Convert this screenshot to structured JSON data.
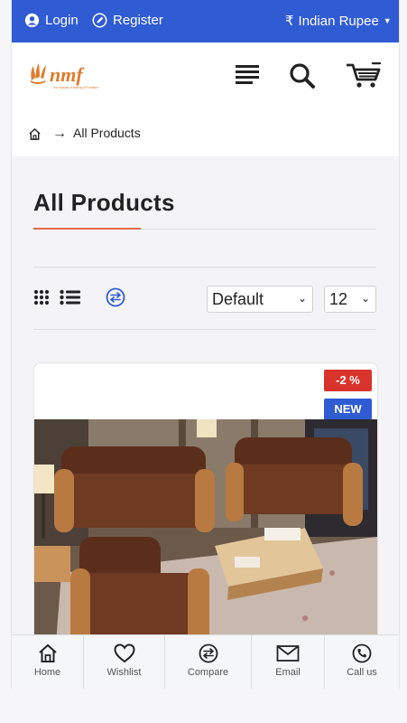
{
  "topbar": {
    "login": "Login",
    "register": "Register",
    "currency_symbol": "₹",
    "currency": "Indian Rupee"
  },
  "brand": {
    "logo_text": "nmf",
    "logo_tagline": "Your Natural of Making of Furniture"
  },
  "header": {
    "icons": [
      "menu-icon",
      "search-icon",
      "cart-icon"
    ]
  },
  "breadcrumb": {
    "arrow": "→",
    "current": "All Products"
  },
  "page": {
    "title": "All Products"
  },
  "toolbar": {
    "sort_value": "Default",
    "per_page_value": "12"
  },
  "product": {
    "discount_badge": "-2 %",
    "new_badge": "NEW"
  },
  "bottom_nav": [
    {
      "label": "Home",
      "icon": "home-icon"
    },
    {
      "label": "Wishlist",
      "icon": "heart-icon"
    },
    {
      "label": "Compare",
      "icon": "compare-icon"
    },
    {
      "label": "Email",
      "icon": "mail-icon"
    },
    {
      "label": "Call us",
      "icon": "phone-icon"
    }
  ],
  "colors": {
    "primary": "#2f5bd3",
    "accent": "#e46b4a",
    "discount": "#d9342b"
  }
}
